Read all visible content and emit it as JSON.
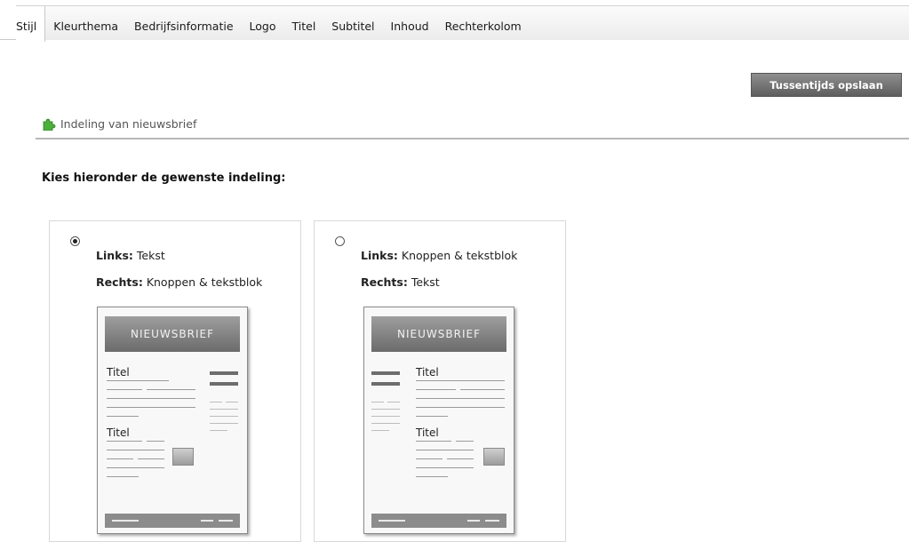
{
  "tabs": [
    {
      "label": "Stijl",
      "active": true
    },
    {
      "label": "Kleurthema"
    },
    {
      "label": "Bedrijfsinformatie"
    },
    {
      "label": "Logo"
    },
    {
      "label": "Titel"
    },
    {
      "label": "Subtitel"
    },
    {
      "label": "Inhoud"
    },
    {
      "label": "Rechterkolom"
    }
  ],
  "save_button": "Tussentijds opslaan",
  "section_title": "Indeling van nieuwsbrief",
  "instruction": "Kies hieronder de gewenste indeling:",
  "options": [
    {
      "selected": true,
      "left_label": "Links:",
      "left_value": "Tekst",
      "right_label": "Rechts:",
      "right_value": "Knoppen & tekstblok",
      "preview_header": "NIEUWSBRIEF",
      "preview_title1": "Titel",
      "preview_title2": "Titel"
    },
    {
      "selected": false,
      "left_label": "Links:",
      "left_value": "Knoppen & tekstblok",
      "right_label": "Rechts:",
      "right_value": "Tekst",
      "preview_header": "NIEUWSBRIEF",
      "preview_title1": "Titel",
      "preview_title2": "Titel"
    }
  ],
  "icons": {
    "section": "puzzle-piece-icon"
  },
  "colors": {
    "button_bg": "#6e6e6e",
    "puzzle_green": "#4caf3a"
  }
}
